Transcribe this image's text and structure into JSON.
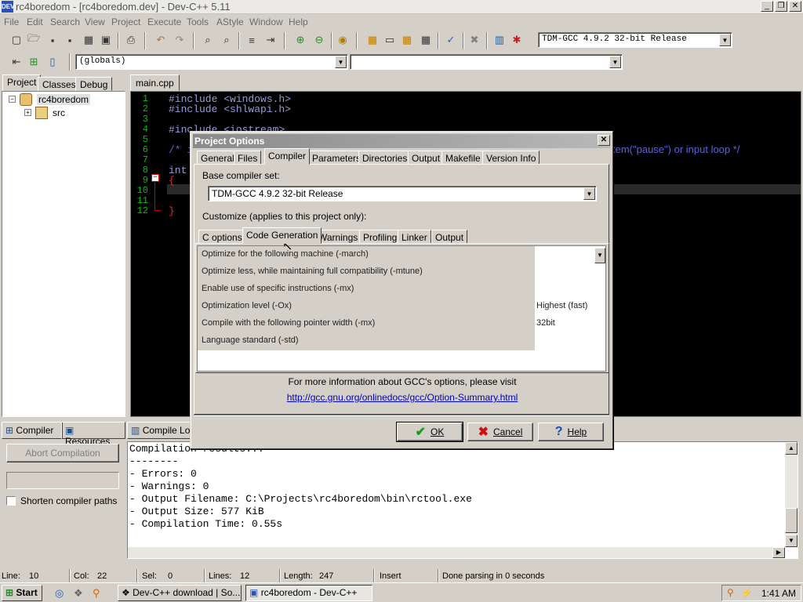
{
  "window": {
    "title": "rc4boredom - [rc4boredom.dev] - Dev-C++ 5.11",
    "icon_label": "DEV"
  },
  "menu": [
    "File",
    "Edit",
    "Search",
    "View",
    "Project",
    "Execute",
    "Tools",
    "AStyle",
    "Window",
    "Help"
  ],
  "toolbar": {
    "compiler_select": "TDM-GCC 4.9.2 32-bit Release",
    "scope_select": "(globals)",
    "symbol_select": ""
  },
  "left_panel": {
    "tabs": [
      "Project",
      "Classes",
      "Debug"
    ],
    "tree": {
      "root": "rc4boredom",
      "child": "src"
    }
  },
  "editor": {
    "tab": "main.cpp",
    "line_numbers": [
      "1",
      "2",
      "3",
      "4",
      "5",
      "6",
      "7",
      "8",
      "9",
      "10",
      "11",
      "12"
    ],
    "lines": [
      "#include <windows.h>",
      "#include <shlwapi.h>",
      "",
      "#include <iostream>",
      "",
      "/* i",
      "",
      "int",
      "{",
      "",
      "",
      "}"
    ],
    "right_fragment": "tem(\"pause\") or input loop */"
  },
  "dialog": {
    "title": "Project Options",
    "tabs": [
      "General",
      "Files",
      "Compiler",
      "Parameters",
      "Directories",
      "Output",
      "Makefile",
      "Version Info"
    ],
    "base_compiler_label": "Base compiler set:",
    "base_compiler_value": "TDM-GCC 4.9.2 32-bit Release",
    "customize_label": "Customize (applies to this project only):",
    "subtabs": [
      "C options",
      "Code Generation",
      "Warnings",
      "Profiling",
      "Linker",
      "Output"
    ],
    "options": [
      {
        "label": "Optimize for the following machine (-march)",
        "value": ""
      },
      {
        "label": "Optimize less, while maintaining full compatibility (-mtune)",
        "value": ""
      },
      {
        "label": "Enable use of specific instructions (-mx)",
        "value": ""
      },
      {
        "label": "Optimization level (-Ox)",
        "value": "Highest (fast)"
      },
      {
        "label": "Compile with the following pointer width (-mx)",
        "value": "32bit"
      },
      {
        "label": "Language standard (-std)",
        "value": ""
      }
    ],
    "info_text": "For more information about GCC's options, please visit",
    "info_link": "http://gcc.gnu.org/onlinedocs/gcc/Option-Summary.html",
    "ok": "OK",
    "cancel": "Cancel",
    "help": "Help"
  },
  "bottom_panel": {
    "tabs": [
      "Compiler",
      "Resources",
      "Compile Lo"
    ],
    "abort_button": "Abort Compilation",
    "shorten_label": "Shorten compiler paths",
    "output": [
      "Compilation results...",
      "--------",
      "- Errors: 0",
      "- Warnings: 0",
      "- Output Filename: C:\\Projects\\rc4boredom\\bin\\rctool.exe",
      "- Output Size: 577 KiB",
      "- Compilation Time: 0.55s"
    ]
  },
  "status": {
    "line_label": "Line:",
    "line": "10",
    "col_label": "Col:",
    "col": "22",
    "sel_label": "Sel:",
    "sel": "0",
    "lines_label": "Lines:",
    "lines": "12",
    "length_label": "Length:",
    "length": "247",
    "mode": "Insert",
    "message": "Done parsing in 0 seconds"
  },
  "taskbar": {
    "start": "Start",
    "tasks": [
      "Dev-C++ download | So...",
      "rc4boredom - Dev-C++"
    ],
    "clock": "1:41 AM"
  }
}
